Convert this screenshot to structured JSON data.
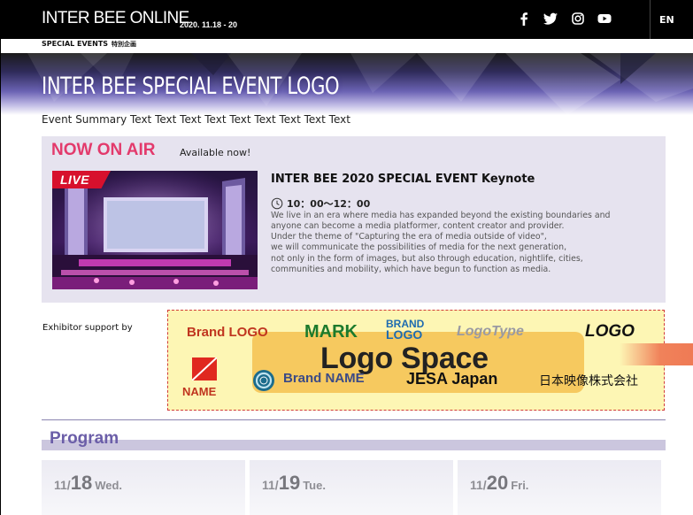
{
  "header": {
    "brand": "INTER BEE ONLINE",
    "dates": "2020. 11.18 - 20",
    "social_icons": [
      "facebook-icon",
      "twitter-icon",
      "instagram-icon",
      "youtube-icon"
    ],
    "lang": "EN"
  },
  "subnav": {
    "label": "SPECIAL EVENTS",
    "jp": "特別企画"
  },
  "hero": {
    "title": "INTER BEE SPECIAL EVENT LOGO",
    "summary": "Event Summary Text Text Text Text Text Text Text Text Text"
  },
  "now_on_air": {
    "heading": "NOW ON AIR",
    "sub": "Available now!",
    "live_badge": "LIVE",
    "event_title": "INTER BEE 2020 SPECIAL EVENT  Keynote",
    "time": "10：00〜12：00",
    "description": [
      "We live in an era where media has expanded beyond the existing boundaries and",
      "anyone can become a media platformer, content creator and provider.",
      "Under the theme of \"Capturing the era of media outside of video\",",
      "we will communicate the possibilities of media for the next generation,",
      "not only in the form of images, but also through education, nightlife, cities,",
      "communities and mobility, which have begun to function as media."
    ]
  },
  "exhibitor": {
    "label": "Exhibitor support by",
    "logos": {
      "brand_logo": "Brand LOGO",
      "mark": "MARK",
      "brand_logo_stack_1": "BRAND",
      "brand_logo_stack_2": "LOGO",
      "logotype": "LogoType",
      "logo": "LOGO",
      "name": "NAME",
      "brand_name": "Brand NAME",
      "jesa": "JESA Japan",
      "jp_company": "日本映像株式会社"
    },
    "logo_space": "Logo Space"
  },
  "program": {
    "title": "Program",
    "days": [
      {
        "month": "11/",
        "day": "18",
        "weekday": "Wed."
      },
      {
        "month": "11/",
        "day": "19",
        "weekday": "Tue."
      },
      {
        "month": "11/",
        "day": "20",
        "weekday": "Fri."
      }
    ]
  },
  "colors": {
    "accent_pink": "#e33a6c",
    "live_red": "#d7102d",
    "program_purple": "#6b5ea8",
    "logo_box_yellow": "#fdf6b4",
    "logo_space_orange": "#f6c95f"
  }
}
